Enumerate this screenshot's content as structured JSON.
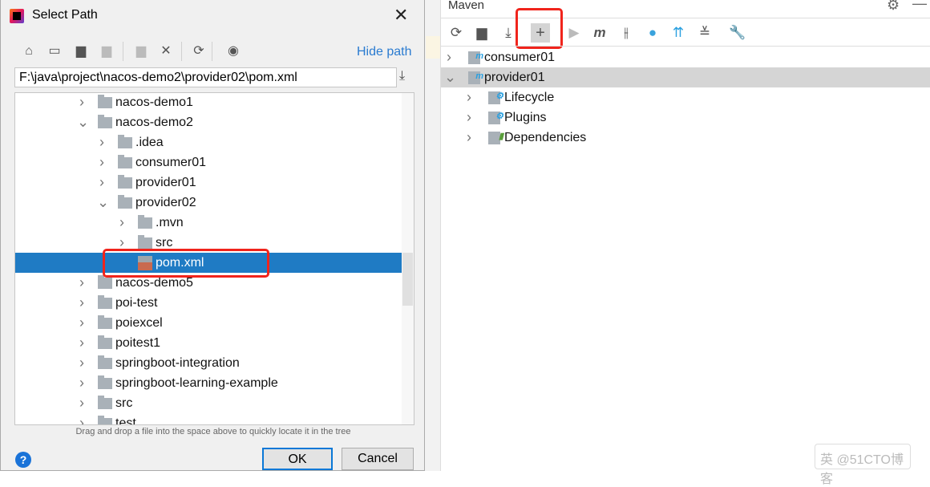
{
  "dialog": {
    "title": "Select Path",
    "hide_path": "Hide path",
    "path_value": "F:\\java\\project\\nacos-demo2\\provider02\\pom.xml",
    "toolbar_icons": [
      "home-icon",
      "desktop-icon",
      "project-folder-icon",
      "module-folder-icon",
      "new-folder-icon",
      "delete-icon",
      "refresh-icon",
      "show-hidden-icon"
    ],
    "tree": [
      {
        "label": "nacos-demo1",
        "level": 0,
        "state": "collapsed",
        "type": "folder"
      },
      {
        "label": "nacos-demo2",
        "level": 0,
        "state": "expanded",
        "type": "folder"
      },
      {
        "label": ".idea",
        "level": 1,
        "state": "collapsed",
        "type": "folder"
      },
      {
        "label": "consumer01",
        "level": 1,
        "state": "collapsed",
        "type": "folder"
      },
      {
        "label": "provider01",
        "level": 1,
        "state": "collapsed",
        "type": "folder"
      },
      {
        "label": "provider02",
        "level": 1,
        "state": "expanded",
        "type": "folder"
      },
      {
        "label": ".mvn",
        "level": 2,
        "state": "collapsed",
        "type": "folder"
      },
      {
        "label": "src",
        "level": 2,
        "state": "collapsed",
        "type": "folder"
      },
      {
        "label": "pom.xml",
        "level": 2,
        "state": "leaf",
        "type": "xml",
        "selected": true
      },
      {
        "label": "nacos-demo5",
        "level": 0,
        "state": "collapsed",
        "type": "folder"
      },
      {
        "label": "poi-test",
        "level": 0,
        "state": "collapsed",
        "type": "folder"
      },
      {
        "label": "poiexcel",
        "level": 0,
        "state": "collapsed",
        "type": "folder"
      },
      {
        "label": "poitest1",
        "level": 0,
        "state": "collapsed",
        "type": "folder"
      },
      {
        "label": "springboot-integration",
        "level": 0,
        "state": "collapsed",
        "type": "folder"
      },
      {
        "label": "springboot-learning-example",
        "level": 0,
        "state": "collapsed",
        "type": "folder"
      },
      {
        "label": "src",
        "level": 0,
        "state": "collapsed",
        "type": "folder"
      },
      {
        "label": "test",
        "level": 0,
        "state": "collapsed",
        "type": "folder"
      }
    ],
    "hint": "Drag and drop a file into the space above to quickly locate it in the tree",
    "ok": "OK",
    "cancel": "Cancel",
    "help": "?"
  },
  "maven": {
    "title": "Maven",
    "toolbar_icons": [
      "reload-icon",
      "generate-sources-icon",
      "download-icon",
      "add-maven-project-icon",
      "run-icon",
      "execute-goal-icon",
      "toggle-offline-icon",
      "skip-tests-icon",
      "show-dependencies-icon",
      "collapse-all-icon",
      "settings-wrench-icon"
    ],
    "tree": [
      {
        "label": "consumer01",
        "level": 0,
        "state": "collapsed",
        "icon": "maven-module"
      },
      {
        "label": "provider01",
        "level": 0,
        "state": "expanded",
        "icon": "maven-module",
        "selected": true
      },
      {
        "label": "Lifecycle",
        "level": 1,
        "state": "collapsed",
        "icon": "lifecycle"
      },
      {
        "label": "Plugins",
        "level": 1,
        "state": "collapsed",
        "icon": "plugins"
      },
      {
        "label": "Dependencies",
        "level": 1,
        "state": "collapsed",
        "icon": "dependencies"
      }
    ]
  },
  "watermark": "英 @51CTO博客",
  "colors": {
    "selection": "#1f7bc4",
    "highlight_box": "#f0241c",
    "link": "#2a7bd0"
  }
}
